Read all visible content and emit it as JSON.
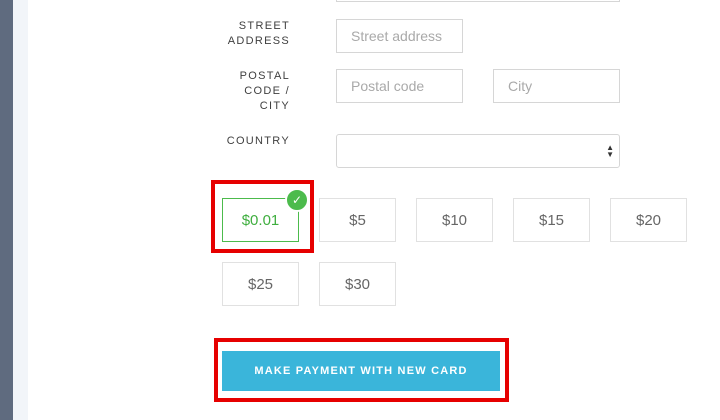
{
  "form": {
    "street_label": "STREET\nADDRESS",
    "street_placeholder": "Street address",
    "postal_label": "POSTAL\nCODE /\nCITY",
    "postal_placeholder": "Postal code",
    "city_placeholder": "City",
    "country_label": "COUNTRY",
    "country_value": ""
  },
  "amounts": {
    "options": [
      "$0.01",
      "$5",
      "$10",
      "$15",
      "$20",
      "$25",
      "$30"
    ],
    "selected": "$0.01"
  },
  "icons": {
    "selected_check": "check-icon",
    "select_arrows": "sort-arrows-icon"
  },
  "payment": {
    "button_label": "MAKE PAYMENT WITH NEW CARD"
  },
  "colors": {
    "accent": "#3ab5da",
    "selected": "#4cbb4c",
    "highlight": "#e60000",
    "sidebar": "#5f6b7f"
  }
}
